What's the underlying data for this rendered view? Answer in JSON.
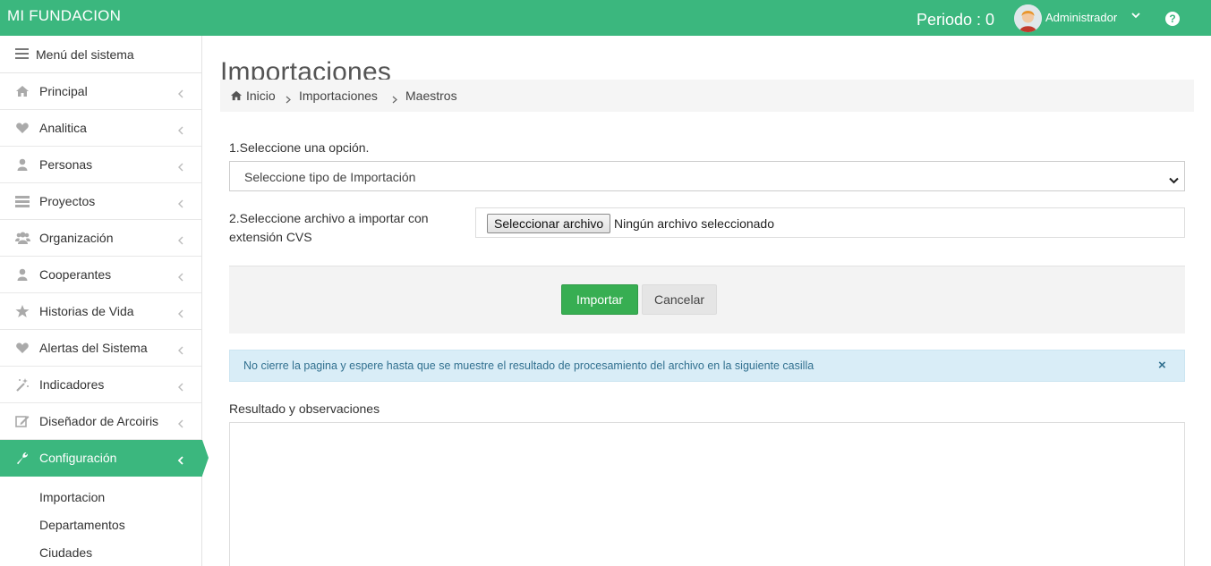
{
  "header": {
    "brand": "MI FUNDACION",
    "periodo": "Periodo : 0",
    "user": "Administrador",
    "help_icon": "question-circle-icon",
    "accent_color": "#3bb77e"
  },
  "sidebar": {
    "menu_title": "Menú del sistema",
    "items": [
      {
        "label": "Principal",
        "icon": "home-icon"
      },
      {
        "label": "Analitica",
        "icon": "heart-icon"
      },
      {
        "label": "Personas",
        "icon": "user-icon"
      },
      {
        "label": "Proyectos",
        "icon": "server-icon"
      },
      {
        "label": "Organización",
        "icon": "users-icon"
      },
      {
        "label": "Cooperantes",
        "icon": "user-icon"
      },
      {
        "label": "Historias de Vida",
        "icon": "star-icon"
      },
      {
        "label": "Alertas del Sistema",
        "icon": "heart-icon"
      },
      {
        "label": "Indicadores",
        "icon": "magic-wand-icon"
      },
      {
        "label": "Diseñador de Arcoiris",
        "icon": "edit-icon"
      },
      {
        "label": "Configuración",
        "icon": "wrench-icon",
        "active": true
      }
    ],
    "subitems": [
      "Importacion",
      "Departamentos",
      "Ciudades"
    ]
  },
  "main": {
    "title": "Importaciones",
    "breadcrumb": [
      "Inicio",
      "Importaciones",
      "Maestros"
    ],
    "step1_label": "1.Seleccione una opción.",
    "select_value": "Seleccione tipo de Importación",
    "step2_label": "2.Seleccione archivo a importar con extensión CVS",
    "file_button": "Seleccionar archivo",
    "file_status": "Ningún archivo seleccionado",
    "import_button": "Importar",
    "cancel_button": "Cancelar",
    "alert_text": "No cierre la pagina y espere hasta que se muestre el resultado de procesamiento del archivo en la siguiente casilla",
    "alert_close": "×",
    "result_label": "Resultado y observaciones",
    "result_value": ""
  }
}
